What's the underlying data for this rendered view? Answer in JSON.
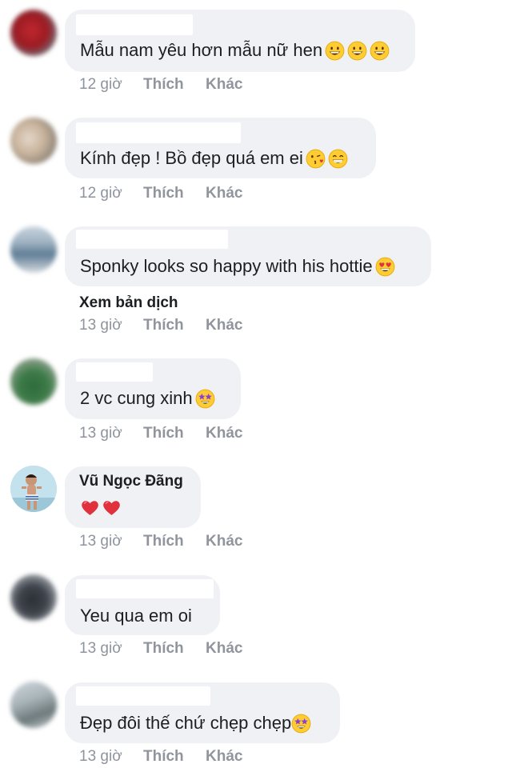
{
  "labels": {
    "like": "Thích",
    "more": "Khác",
    "translate": "Xem bản dịch"
  },
  "comments": [
    {
      "name": "",
      "text": "Mẫu nam yêu hơn mẫu nữ hen",
      "time": "12 giờ",
      "emojis": [
        "grinning-face",
        "grinning-face",
        "grinning-face"
      ]
    },
    {
      "name": "",
      "text": "Kính đẹp ! Bồ đẹp quá em ei",
      "time": "12 giờ",
      "emojis": [
        "kissing-heart-face",
        "beaming-face"
      ]
    },
    {
      "name": "",
      "text": "Sponky looks so happy with his hottie",
      "time": "13 giờ",
      "emojis": [
        "heart-eyes-face"
      ],
      "show_translate": true
    },
    {
      "name": "",
      "text": "2 vc cung xinh",
      "time": "13 giờ",
      "emojis": [
        "star-struck-face"
      ]
    },
    {
      "name": "Vũ Ngọc Đãng",
      "text": "",
      "time": "13 giờ",
      "emojis": [
        "red-heart",
        "red-heart"
      ]
    },
    {
      "name": "",
      "text": "Yeu qua em oi",
      "time": "13 giờ",
      "emojis": []
    },
    {
      "name": "",
      "text": "Đẹp đôi thế chứ chẹp chẹp",
      "time": "13 giờ",
      "emojis": [
        "star-struck-face"
      ]
    }
  ],
  "colors": {
    "bubble": "#f0f1f4",
    "meta": "#8d949e",
    "text": "#1c1e21",
    "emoji_yellow": "#ffcc33",
    "heart_red": "#e0323c"
  }
}
